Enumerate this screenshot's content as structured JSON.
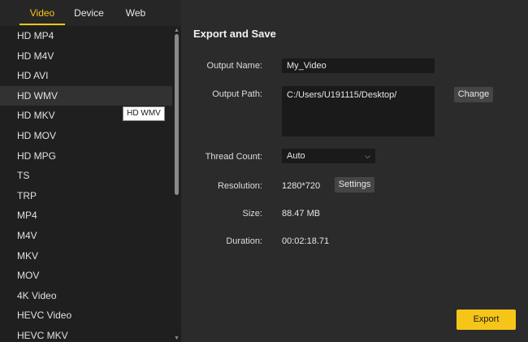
{
  "tabs": [
    "Video",
    "Device",
    "Web"
  ],
  "formats": [
    "HD MP4",
    "HD M4V",
    "HD AVI",
    "HD WMV",
    "HD MKV",
    "HD MOV",
    "HD MPG",
    "TS",
    "TRP",
    "MP4",
    "M4V",
    "MKV",
    "MOV",
    "4K Video",
    "HEVC Video",
    "HEVC MKV"
  ],
  "tooltip": "HD WMV",
  "export": {
    "title": "Export and Save",
    "output_name_label": "Output Name:",
    "output_name_value": "My_Video",
    "output_path_label": "Output Path:",
    "output_path_value": "C:/Users/U191115/Desktop/",
    "change_label": "Change",
    "thread_count_label": "Thread Count:",
    "thread_count_value": "Auto",
    "resolution_label": "Resolution:",
    "resolution_value": "1280*720",
    "settings_label": "Settings",
    "size_label": "Size:",
    "size_value": "88.47 MB",
    "duration_label": "Duration:",
    "duration_value": "00:02:18.71",
    "export_label": "Export"
  },
  "colors": {
    "accent": "#f5c518",
    "panel": "#1f1f1f",
    "background": "#2b2b2b"
  }
}
